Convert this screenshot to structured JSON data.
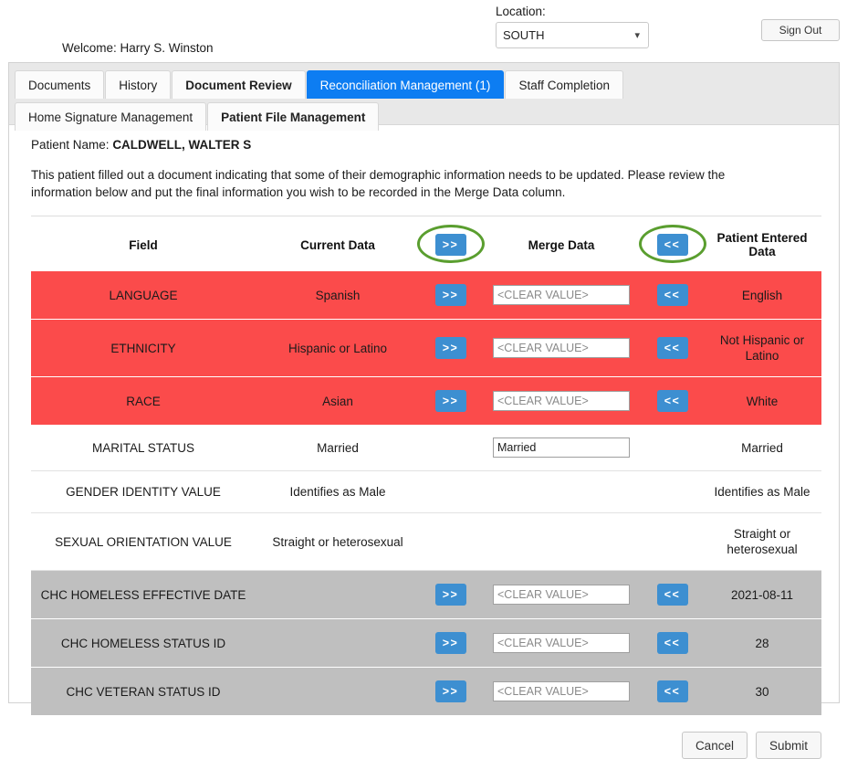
{
  "header": {
    "welcome_label": "Welcome:",
    "welcome_user": "Harry S. Winston",
    "welcome_full": "Welcome: Harry S. Winston",
    "location_label": "Location:",
    "location_value": "SOUTH",
    "location_options": [
      "SOUTH"
    ],
    "sign_out_label": "Sign Out",
    "chevron": "⌄"
  },
  "tabs": {
    "row1": [
      {
        "label": "Documents",
        "active": false,
        "bold": false
      },
      {
        "label": "History",
        "active": false,
        "bold": false
      },
      {
        "label": "Document Review",
        "active": false,
        "bold": true
      },
      {
        "label": "Reconciliation Management (1)",
        "active": true,
        "bold": false
      },
      {
        "label": "Staff Completion",
        "active": false,
        "bold": false
      }
    ],
    "row2": [
      {
        "label": "Home Signature Management",
        "active": false,
        "bold": false
      },
      {
        "label": "Patient File Management",
        "active": false,
        "bold": true
      }
    ]
  },
  "main": {
    "patient_name_label": "Patient Name:",
    "patient_name_value": "CALDWELL, WALTER S",
    "instructions": "This patient filled out a document indicating that some of their demographic information needs to be updated. Please review the information below and put the final information you wish to be recorded in the Merge Data column."
  },
  "table": {
    "headers": {
      "field": "Field",
      "current_data": "Current Data",
      "push_right": ">>",
      "merge_data": "Merge Data",
      "push_left": "<<",
      "patient_entered_data": "Patient Entered Data"
    },
    "rows": [
      {
        "field": "LANGUAGE",
        "current": "Spanish",
        "push_right": ">>",
        "merge_value": "",
        "merge_placeholder": "<CLEAR VALUE>",
        "push_left": "<<",
        "patient": "English",
        "state": "red",
        "has_arrows": true,
        "has_input": true
      },
      {
        "field": "ETHNICITY",
        "current": "Hispanic or Latino",
        "push_right": ">>",
        "merge_value": "",
        "merge_placeholder": "<CLEAR VALUE>",
        "push_left": "<<",
        "patient": "Not Hispanic or Latino",
        "state": "red",
        "has_arrows": true,
        "has_input": true
      },
      {
        "field": "RACE",
        "current": "Asian",
        "push_right": ">>",
        "merge_value": "",
        "merge_placeholder": "<CLEAR VALUE>",
        "push_left": "<<",
        "patient": "White",
        "state": "red",
        "has_arrows": true,
        "has_input": true
      },
      {
        "field": "MARITAL STATUS",
        "current": "Married",
        "push_right": "",
        "merge_value": "Married",
        "merge_placeholder": "",
        "push_left": "",
        "patient": "Married",
        "state": "normal",
        "has_arrows": false,
        "has_input": true
      },
      {
        "field": "GENDER IDENTITY VALUE",
        "current": "Identifies as Male",
        "push_right": "",
        "merge_value": "",
        "merge_placeholder": "",
        "push_left": "",
        "patient": "Identifies as Male",
        "state": "normal",
        "has_arrows": false,
        "has_input": false
      },
      {
        "field": "SEXUAL ORIENTATION VALUE",
        "current": "Straight or heterosexual",
        "push_right": "",
        "merge_value": "",
        "merge_placeholder": "",
        "push_left": "",
        "patient": "Straight or heterosexual",
        "state": "normal",
        "has_arrows": false,
        "has_input": false
      },
      {
        "field": "CHC HOMELESS EFFECTIVE DATE",
        "current": "",
        "push_right": ">>",
        "merge_value": "",
        "merge_placeholder": "<CLEAR VALUE>",
        "push_left": "<<",
        "patient": "2021-08-11",
        "state": "gray",
        "has_arrows": true,
        "has_input": true
      },
      {
        "field": "CHC HOMELESS STATUS ID",
        "current": "",
        "push_right": ">>",
        "merge_value": "",
        "merge_placeholder": "<CLEAR VALUE>",
        "push_left": "<<",
        "patient": "28",
        "state": "gray",
        "has_arrows": true,
        "has_input": true
      },
      {
        "field": "CHC VETERAN STATUS ID",
        "current": "",
        "push_right": ">>",
        "merge_value": "",
        "merge_placeholder": "<CLEAR VALUE>",
        "push_left": "<<",
        "patient": "30",
        "state": "gray",
        "has_arrows": true,
        "has_input": true
      }
    ]
  },
  "footer": {
    "cancel_label": "Cancel",
    "submit_label": "Submit"
  },
  "colors": {
    "changed_row": "#fb4b4b",
    "new_row": "#bfbfbf",
    "arrow_button": "#3d8fd1",
    "active_tab": "#0d7df2",
    "annotation": "#5a9e2f"
  }
}
